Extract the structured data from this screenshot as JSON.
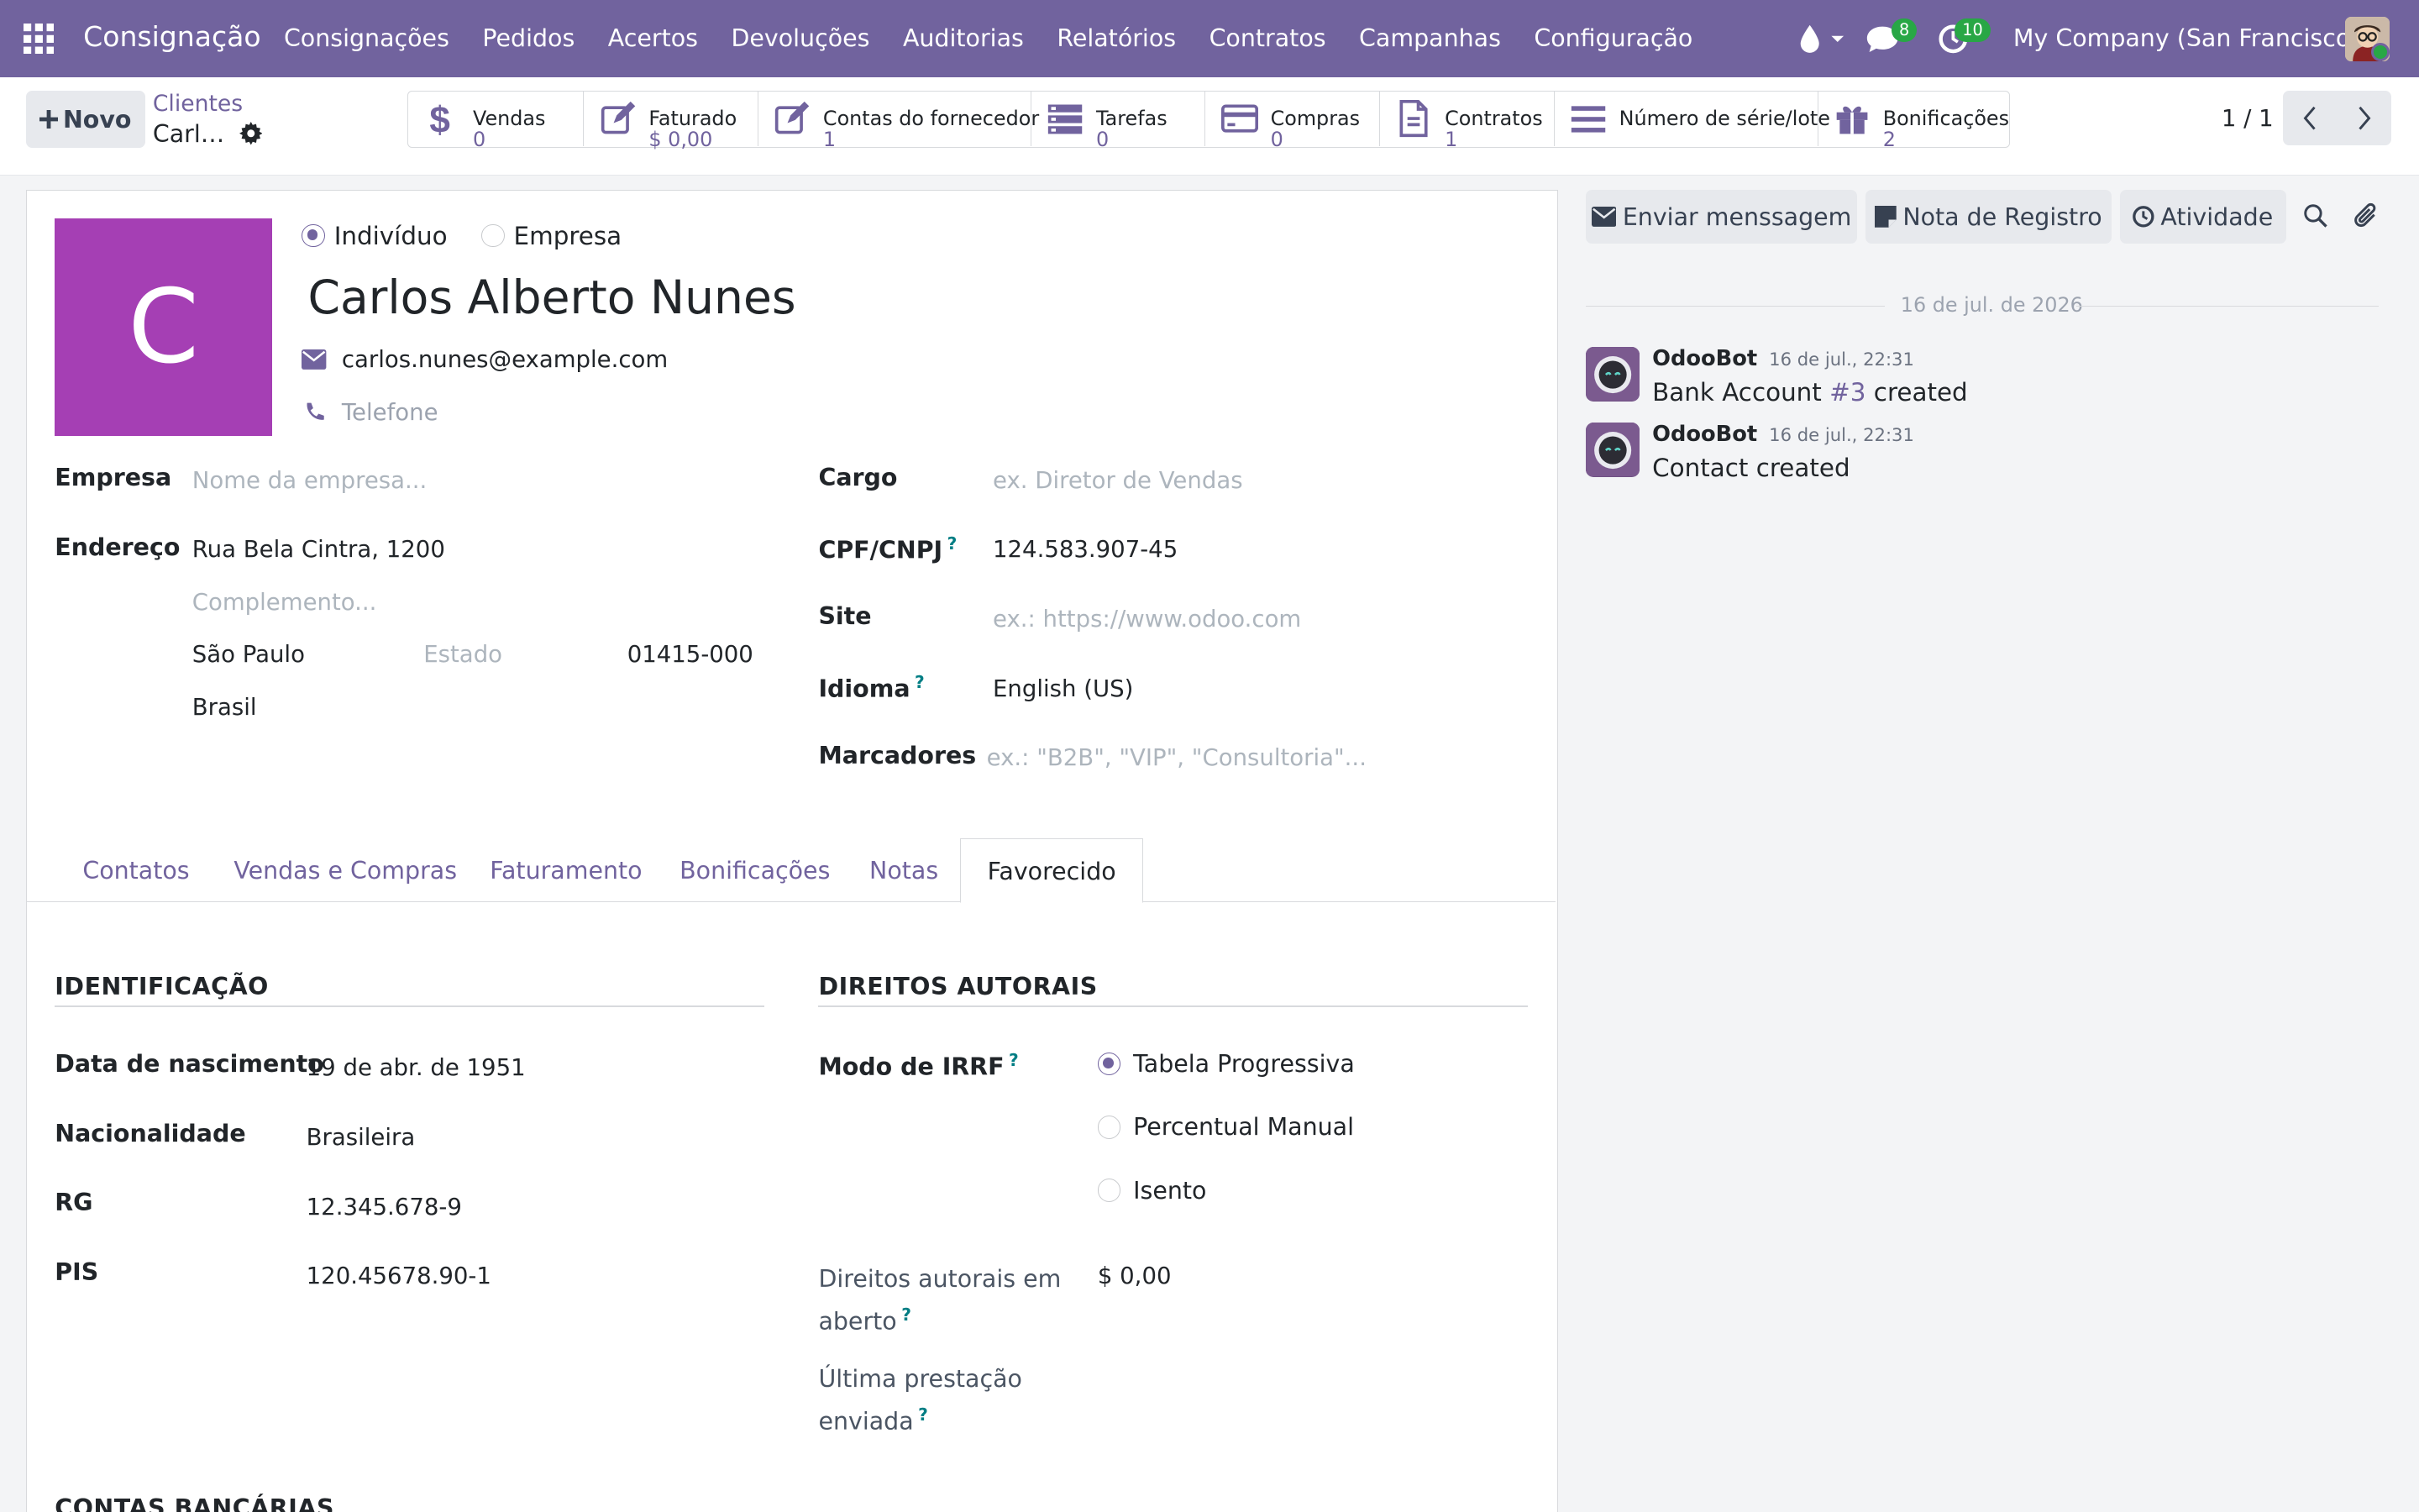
{
  "app": {
    "brand": "Consignação"
  },
  "menu": [
    "Consignações",
    "Pedidos",
    "Acertos",
    "Devoluções",
    "Auditorias",
    "Relatórios",
    "Contratos",
    "Campanhas",
    "Configuração"
  ],
  "systray": {
    "messages_count": "8",
    "activities_count": "10",
    "company": "My Company (San Francisco)"
  },
  "control": {
    "new_label": "Novo",
    "breadcrumb_parent": "Clientes",
    "breadcrumb_current": "Carl…",
    "pager": "1 / 1",
    "stats": [
      {
        "label": "Vendas",
        "value": "0",
        "icon": "dollar-icon"
      },
      {
        "label": "Faturado",
        "value": "$ 0,00",
        "icon": "edit-icon"
      },
      {
        "label": "Contas do fornecedor",
        "value": "1",
        "icon": "edit-icon"
      },
      {
        "label": "Tarefas",
        "value": "0",
        "icon": "tasks-icon"
      },
      {
        "label": "Compras",
        "value": "0",
        "icon": "credit-card-icon"
      },
      {
        "label": "Contratos",
        "value": "1",
        "icon": "file-icon"
      },
      {
        "label": "Número de série/lote",
        "value": "",
        "icon": "bars-icon"
      },
      {
        "label": "Bonificações",
        "value": "2",
        "icon": "gift-icon"
      }
    ]
  },
  "form": {
    "type_individual": "Indivíduo",
    "type_company": "Empresa",
    "avatar_letter": "C",
    "name": "Carlos Alberto Nunes",
    "email": "carlos.nunes@example.com",
    "phone_placeholder": "Telefone",
    "left": {
      "company_label": "Empresa",
      "company_placeholder": "Nome da empresa...",
      "address_label": "Endereço",
      "street": "Rua Bela Cintra, 1200",
      "street2_placeholder": "Complemento...",
      "city": "São Paulo",
      "state_placeholder": "Estado",
      "zip": "01415-000",
      "country": "Brasil"
    },
    "right": {
      "job_label": "Cargo",
      "job_placeholder": "ex. Diretor de Vendas",
      "vat_label": "CPF/CNPJ",
      "vat": "124.583.907-45",
      "site_label": "Site",
      "site_placeholder": "ex.: https://www.odoo.com",
      "lang_label": "Idioma",
      "lang": "English (US)",
      "tags_label": "Marcadores",
      "tags_placeholder": "ex.: \"B2B\", \"VIP\", \"Consultoria\"..."
    },
    "help_mark": "?",
    "tabs": [
      "Contatos",
      "Vendas e Compras",
      "Faturamento",
      "Bonificações",
      "Notas",
      "Favorecido"
    ],
    "active_tab": "Favorecido",
    "ident": {
      "title": "IDENTIFICAÇÃO",
      "rows": [
        {
          "label": "Data de nascimento",
          "value": "19 de abr. de 1951"
        },
        {
          "label": "Nacionalidade",
          "value": "Brasileira"
        },
        {
          "label": "RG",
          "value": "12.345.678-9"
        },
        {
          "label": "PIS",
          "value": "120.45678.90-1"
        }
      ]
    },
    "rights": {
      "title": "DIREITOS AUTORAIS",
      "irrf_label": "Modo de IRRF",
      "irrf_options": [
        "Tabela Progressiva",
        "Percentual Manual",
        "Isento"
      ],
      "irrf_selected": "Tabela Progressiva",
      "open_label_1": "Direitos autorais em",
      "open_label_2": "aberto",
      "open_value": "$ 0,00",
      "last_label_1": "Última prestação",
      "last_label_2": "enviada"
    },
    "next_section": "CONTAS BANCÁRIAS"
  },
  "chatter": {
    "send_message": "Enviar menssagem",
    "log_note": "Nota de Registro",
    "activity": "Atividade",
    "date_sep": "16 de jul. de 2026",
    "messages": [
      {
        "author": "OdooBot",
        "time": "16 de jul., 22:31",
        "text_before": "Bank Account ",
        "link": "#3",
        "text_after": " created"
      },
      {
        "author": "OdooBot",
        "time": "16 de jul., 22:31",
        "text": "Contact created"
      }
    ]
  }
}
